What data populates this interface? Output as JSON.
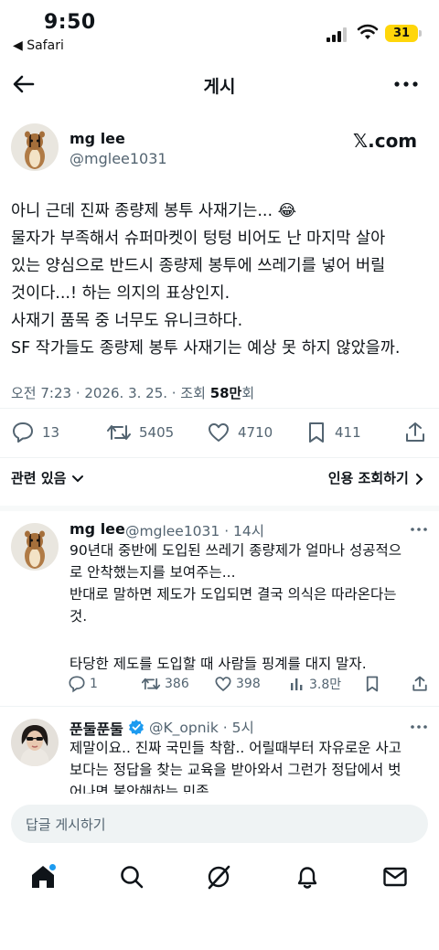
{
  "status_bar": {
    "time": "9:50",
    "back_app": "◀ Safari",
    "battery": "31",
    "battery_color": "#ffd60a"
  },
  "header": {
    "title": "게시"
  },
  "post": {
    "author_name": "mg lee",
    "author_handle": "@mglee1031",
    "source_label": "𝕏.com",
    "lines": [
      "아니 근데 진짜 종량제 봉투 사재기는... 😂",
      "물자가 부족해서 슈퍼마켓이 텅텅 비어도 난 마지막 살아",
      "있는 양심으로 반드시 종량제 봉투에 쓰레기를 넣어 버릴",
      "것이다...! 하는 의지의 표상인지.",
      "사재기 품목 중 너무도 유니크하다.",
      "SF 작가들도 종량제 봉투 사재기는 예상 못 하지 않았을까."
    ],
    "meta_prefix": "오전 7:23 · 2026. 3. 25. · 조회 ",
    "meta_views": "58만",
    "meta_suffix": "회",
    "replies": "13",
    "reposts": "5405",
    "likes": "4710",
    "bookmarks": "411",
    "related_label": "관련 있음",
    "quotes_label": "인용 조회하기"
  },
  "replies": [
    {
      "name": "mg lee",
      "handle_time": "@mglee1031 · 14시",
      "lines": [
        "90년대 중반에 도입된 쓰레기 종량제가 얼마나 성공적으",
        "로 안착했는지를 보여주는...",
        "반대로 말하면 제도가 도입되면 결국 의식은 따라온다는",
        "것.",
        "",
        "타당한 제도를 도입할 때 사람들 핑계를 대지 말자."
      ],
      "replies": "1",
      "reposts": "386",
      "likes": "398",
      "views": "3.8만"
    },
    {
      "name": "푼둘푼둘",
      "handle_time": "@K_opnik · 5시",
      "verified_color": "#1d9bf0",
      "lines": [
        "제말이요.. 진짜 국민들 착함.. 어릴때부터 자유로운 사고",
        "보다는 정답을 찾는 교육을 받아와서 그런가 정답에서 벗",
        "어나면 불안해하는 민족"
      ]
    }
  ],
  "reply_box": {
    "placeholder": "답글 게시하기"
  },
  "colors": {
    "accent": "#1d9bf0",
    "secondary_text": "#536471",
    "primary_text": "#0f1419"
  }
}
